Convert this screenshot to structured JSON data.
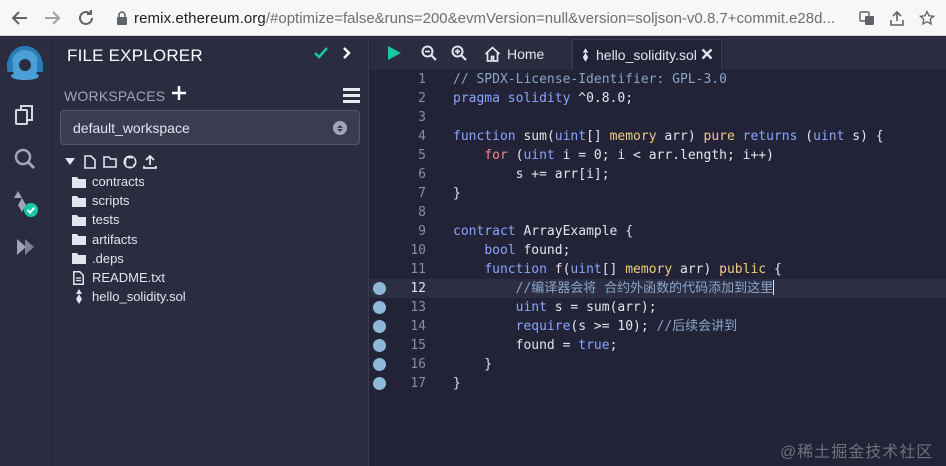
{
  "browser": {
    "url_host": "remix.ethereum.org",
    "url_rest": "/#optimize=false&runs=200&evmVersion=null&version=soljson-v0.8.7+commit.e28d..."
  },
  "rail": {
    "icons": [
      "remix-logo-icon",
      "file-explorer-icon",
      "search-icon",
      "solidity-compiler-icon",
      "deploy-run-icon"
    ]
  },
  "panel": {
    "title": "FILE EXPLORER",
    "workspaces_label": "WORKSPACES",
    "workspace_selected": "default_workspace",
    "tree": [
      {
        "type": "folder",
        "label": "contracts"
      },
      {
        "type": "folder",
        "label": "scripts"
      },
      {
        "type": "folder",
        "label": "tests"
      },
      {
        "type": "folder",
        "label": "artifacts"
      },
      {
        "type": "folder",
        "label": ".deps"
      },
      {
        "type": "file",
        "label": "README.txt"
      },
      {
        "type": "solidity",
        "label": "hello_solidity.sol"
      }
    ]
  },
  "tabs": {
    "home_label": "Home",
    "active_label": "hello_solidity.sol"
  },
  "editor": {
    "active_line": 12,
    "breakpoint_lines": [
      12,
      13,
      14,
      15,
      16,
      17
    ],
    "lines": [
      "// SPDX-License-Identifier: GPL-3.0",
      "pragma solidity ^0.8.0;",
      "",
      "function sum(uint[] memory arr) pure returns (uint s) {",
      "    for (uint i = 0; i < arr.length; i++)",
      "        s += arr[i];",
      "}",
      "",
      "contract ArrayExample {",
      "    bool found;",
      "    function f(uint[] memory arr) public {",
      "        //编译器会将 合约外函数的代码添加到这里",
      "        uint s = sum(arr);",
      "        require(s >= 10); //后续会讲到",
      "        found = true;",
      "    }",
      "}"
    ]
  },
  "watermark": "@稀土掘金技术社区",
  "colors": {
    "accent_green": "#1ac7a3",
    "run_green": "#1ac7a3",
    "breakpoint": "#8fb8d8"
  }
}
